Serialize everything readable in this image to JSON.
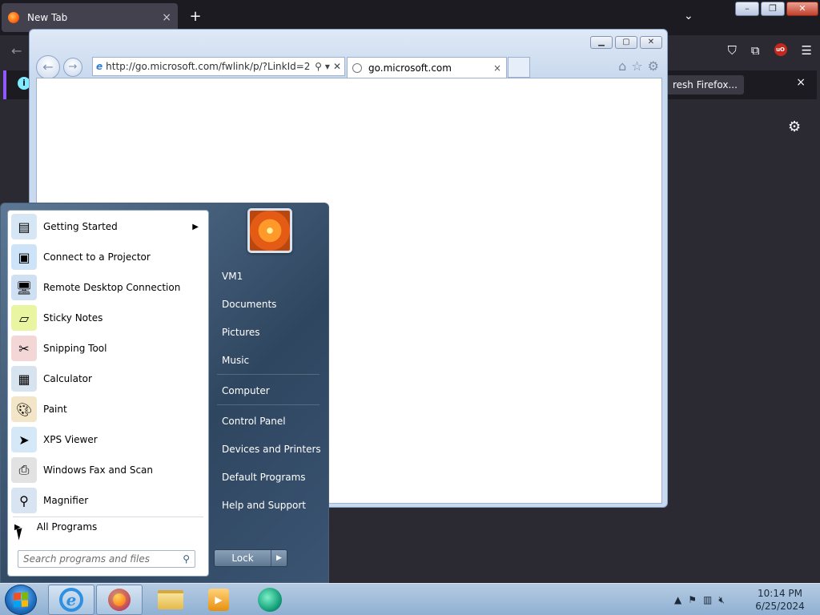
{
  "firefox": {
    "tab_title": "New Tab",
    "tab_close": "×",
    "new_tab": "+",
    "list_tabs": "⌄",
    "notification_button": "resh Firefox...",
    "notification_close": "×"
  },
  "ie": {
    "address": "http://go.microsoft.com/fwlink/p/?LinkId=2",
    "tab_title": "go.microsoft.com",
    "tab_close": "×"
  },
  "start_menu": {
    "programs": [
      {
        "label": "Getting Started",
        "icon": "getting-started-icon",
        "submenu": true
      },
      {
        "label": "Connect to a Projector",
        "icon": "projector-icon",
        "submenu": false
      },
      {
        "label": "Remote Desktop Connection",
        "icon": "remote-desktop-icon",
        "submenu": false
      },
      {
        "label": "Sticky Notes",
        "icon": "sticky-notes-icon",
        "submenu": false
      },
      {
        "label": "Snipping Tool",
        "icon": "snipping-tool-icon",
        "submenu": false
      },
      {
        "label": "Calculator",
        "icon": "calculator-icon",
        "submenu": false
      },
      {
        "label": "Paint",
        "icon": "paint-icon",
        "submenu": false
      },
      {
        "label": "XPS Viewer",
        "icon": "xps-viewer-icon",
        "submenu": false
      },
      {
        "label": "Windows Fax and Scan",
        "icon": "fax-scan-icon",
        "submenu": false
      },
      {
        "label": "Magnifier",
        "icon": "magnifier-icon",
        "submenu": false
      }
    ],
    "all_programs": "All Programs",
    "search_placeholder": "Search programs and files",
    "right_links": [
      "VM1",
      "Documents",
      "Pictures",
      "Music",
      "Computer",
      "Control Panel",
      "Devices and Printers",
      "Default Programs",
      "Help and Support"
    ],
    "lock_label": "Lock"
  },
  "taskbar": {
    "clock_time": "10:14 PM",
    "clock_date": "6/25/2024"
  },
  "colors": {
    "firefox_bg": "#2b2a33",
    "start_menu_blue": "#2f4660",
    "taskbar": "#8fb0d3"
  }
}
